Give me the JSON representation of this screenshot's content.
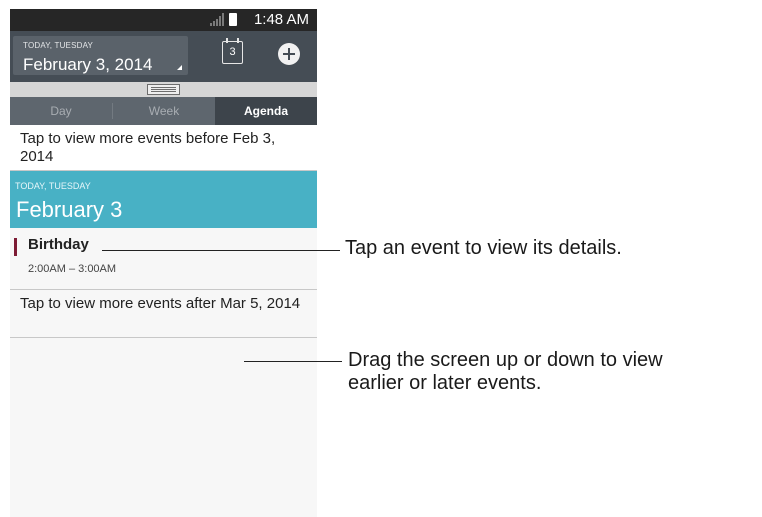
{
  "status_bar": {
    "time": "1:48 AM",
    "icons": [
      "signal-icon",
      "battery-icon"
    ]
  },
  "header": {
    "date_label": "TODAY, TUESDAY",
    "date_value": "February 3, 2014",
    "today_icon_number": "3",
    "icons": [
      "calendar-today-icon",
      "add-icon"
    ]
  },
  "tabs": [
    {
      "label": "Day",
      "active": false
    },
    {
      "label": "Week",
      "active": false
    },
    {
      "label": "Agenda",
      "active": true
    }
  ],
  "agenda": {
    "more_before": "Tap to view more events before Feb 3, 2014",
    "day_header": {
      "label": "TODAY, TUESDAY",
      "date": "February 3"
    },
    "event": {
      "title": "Birthday",
      "time": "2:00AM – 3:00AM",
      "color": "#7d1b34"
    },
    "more_after": "Tap to view more events after Mar 5, 2014"
  },
  "callouts": {
    "event": "Tap an event to view its details.",
    "drag_line1": "Drag the screen up or down to view",
    "drag_line2": "earlier or later events."
  },
  "colors": {
    "header": "#454d55",
    "day_header": "#48b1c5",
    "active_tab": "#3d444b"
  }
}
